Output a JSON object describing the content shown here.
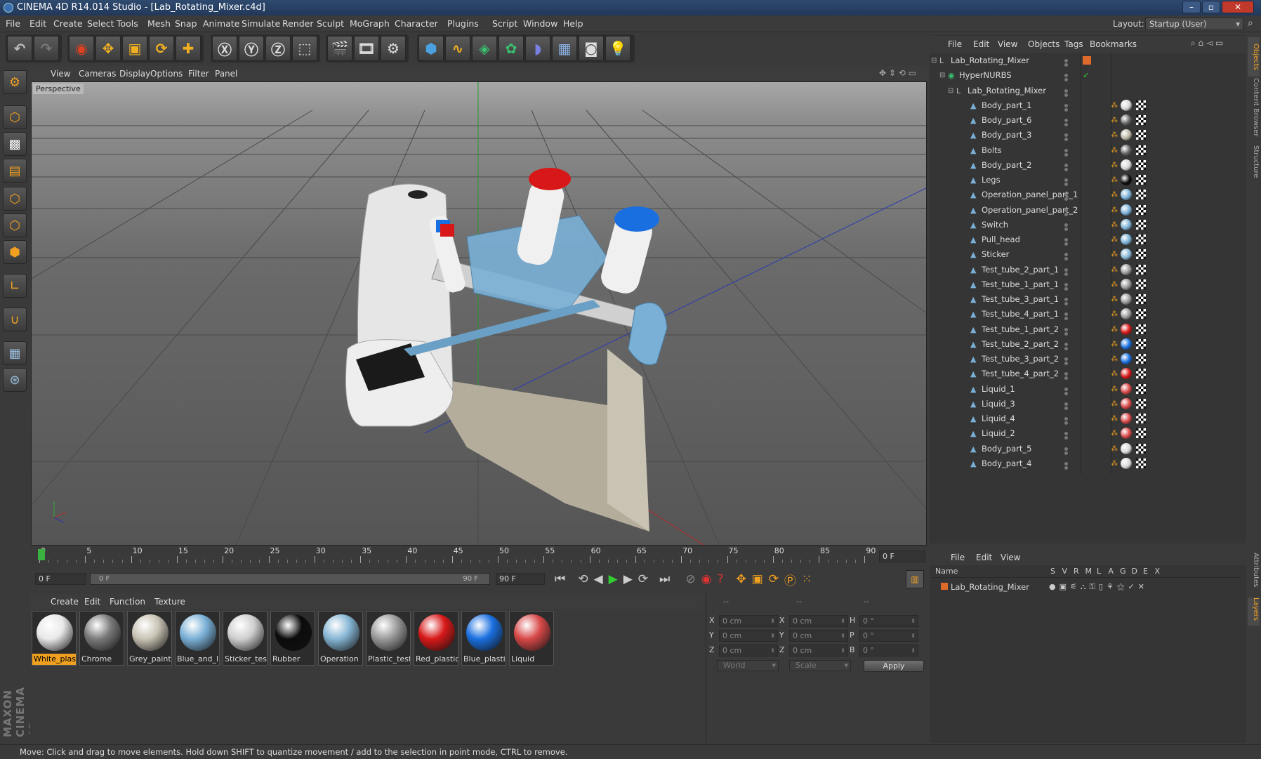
{
  "window": {
    "title": "CINEMA 4D R14.014 Studio - [Lab_Rotating_Mixer.c4d]",
    "layout_label": "Layout:",
    "layout_value": "Startup (User)"
  },
  "menu": [
    "File",
    "Edit",
    "Create",
    "Select",
    "Tools",
    "Mesh",
    "Snap",
    "Animate",
    "Simulate",
    "Render",
    "Sculpt",
    "MoGraph",
    "Character",
    "Plugins",
    "Script",
    "Window",
    "Help"
  ],
  "viewport": {
    "menu": [
      "View",
      "Cameras",
      "Display",
      "Options",
      "Filter",
      "Panel"
    ],
    "label": "Perspective"
  },
  "timeline": {
    "ticks": [
      "0",
      "5",
      "10",
      "15",
      "20",
      "25",
      "30",
      "35",
      "40",
      "45",
      "50",
      "55",
      "60",
      "65",
      "70",
      "75",
      "80",
      "85",
      "90"
    ],
    "frame_end_field": "0 F",
    "start_field": "0 F",
    "range_start": "0 F",
    "range_end": "90 F",
    "end_field": "90 F"
  },
  "materials": {
    "menu": [
      "Create",
      "Edit",
      "Function",
      "Texture"
    ],
    "items": [
      {
        "name": "White_plas",
        "color": "#e8e8e8"
      },
      {
        "name": "Chrome",
        "color": "#7a7a7a"
      },
      {
        "name": "Grey_paint",
        "color": "#c9c3b4"
      },
      {
        "name": "Blue_and_l",
        "color": "#7ab0d6"
      },
      {
        "name": "Sticker_test",
        "color": "#cfcfcf"
      },
      {
        "name": "Rubber",
        "color": "#0c0c0c"
      },
      {
        "name": "Operation",
        "color": "#86b6d4"
      },
      {
        "name": "Plastic_test",
        "color": "#9a9a9a"
      },
      {
        "name": "Red_plastic",
        "color": "#d81818"
      },
      {
        "name": "Blue_plasti",
        "color": "#1a6fe0"
      },
      {
        "name": "Liquid",
        "color": "#d84848"
      }
    ]
  },
  "coords": {
    "headers": [
      "--",
      "--",
      "--"
    ],
    "rows": [
      {
        "a": "X",
        "av": "0 cm",
        "b": "X",
        "bv": "0 cm",
        "c": "H",
        "cv": "0 °"
      },
      {
        "a": "Y",
        "av": "0 cm",
        "b": "Y",
        "bv": "0 cm",
        "c": "P",
        "cv": "0 °"
      },
      {
        "a": "Z",
        "av": "0 cm",
        "b": "Z",
        "bv": "0 cm",
        "c": "B",
        "cv": "0 °"
      }
    ],
    "world": "World",
    "scale": "Scale",
    "apply": "Apply"
  },
  "objects": {
    "menu": [
      "File",
      "Edit",
      "View",
      "Objects",
      "Tags",
      "Bookmarks"
    ],
    "items": [
      {
        "name": "Lab_Rotating_Mixer",
        "level": 0,
        "type": "null"
      },
      {
        "name": "HyperNURBS",
        "level": 1,
        "type": "nurbs"
      },
      {
        "name": "Lab_Rotating_Mixer",
        "level": 2,
        "type": "null"
      },
      {
        "name": "Body_part_1",
        "level": 3,
        "type": "poly",
        "mat": "#d8d8d8"
      },
      {
        "name": "Body_part_6",
        "level": 3,
        "type": "poly",
        "mat": "#666"
      },
      {
        "name": "Body_part_3",
        "level": 3,
        "type": "poly",
        "mat": "#bdb6a6"
      },
      {
        "name": "Bolts",
        "level": 3,
        "type": "poly",
        "mat": "#666"
      },
      {
        "name": "Body_part_2",
        "level": 3,
        "type": "poly",
        "mat": "#d8d8d8"
      },
      {
        "name": "Legs",
        "level": 3,
        "type": "poly",
        "mat": "#0a0a0a"
      },
      {
        "name": "Operation_panel_part_1",
        "level": 3,
        "type": "poly",
        "mat": "#7ab0d6"
      },
      {
        "name": "Operation_panel_part_2",
        "level": 3,
        "type": "poly",
        "mat": "#7ab0d6"
      },
      {
        "name": "Switch",
        "level": 3,
        "type": "poly",
        "mat": "#7ab0d6"
      },
      {
        "name": "Pull_head",
        "level": 3,
        "type": "poly",
        "mat": "#7ab0d6"
      },
      {
        "name": "Sticker",
        "level": 3,
        "type": "poly",
        "mat": "#86b6d4"
      },
      {
        "name": "Test_tube_2_part_1",
        "level": 3,
        "type": "poly",
        "mat": "#999"
      },
      {
        "name": "Test_tube_1_part_1",
        "level": 3,
        "type": "poly",
        "mat": "#999"
      },
      {
        "name": "Test_tube_3_part_1",
        "level": 3,
        "type": "poly",
        "mat": "#999"
      },
      {
        "name": "Test_tube_4_part_1",
        "level": 3,
        "type": "poly",
        "mat": "#999"
      },
      {
        "name": "Test_tube_1_part_2",
        "level": 3,
        "type": "poly",
        "mat": "#d81818"
      },
      {
        "name": "Test_tube_2_part_2",
        "level": 3,
        "type": "poly",
        "mat": "#1a6fe0"
      },
      {
        "name": "Test_tube_3_part_2",
        "level": 3,
        "type": "poly",
        "mat": "#1a6fe0"
      },
      {
        "name": "Test_tube_4_part_2",
        "level": 3,
        "type": "poly",
        "mat": "#d81818"
      },
      {
        "name": "Liquid_1",
        "level": 3,
        "type": "poly",
        "mat": "#d84848"
      },
      {
        "name": "Liquid_3",
        "level": 3,
        "type": "poly",
        "mat": "#d84848"
      },
      {
        "name": "Liquid_4",
        "level": 3,
        "type": "poly",
        "mat": "#d84848"
      },
      {
        "name": "Liquid_2",
        "level": 3,
        "type": "poly",
        "mat": "#d84848"
      },
      {
        "name": "Body_part_5",
        "level": 3,
        "type": "poly",
        "mat": "#d8d8d8"
      },
      {
        "name": "Body_part_4",
        "level": 3,
        "type": "poly",
        "mat": "#d8d8d8"
      }
    ]
  },
  "layers": {
    "menu": [
      "File",
      "Edit",
      "View"
    ],
    "columns": [
      "Name",
      "S",
      "V",
      "R",
      "M",
      "L",
      "A",
      "G",
      "D",
      "E",
      "X"
    ],
    "row": "Lab_Rotating_Mixer"
  },
  "side_tabs": [
    "Objects",
    "Content Browser",
    "Structure",
    "Attributes",
    "Layers"
  ],
  "brand": "MAXON CINEMA 4D",
  "status": "Move: Click and drag to move elements. Hold down SHIFT to quantize movement / add to the selection in point mode, CTRL to remove."
}
